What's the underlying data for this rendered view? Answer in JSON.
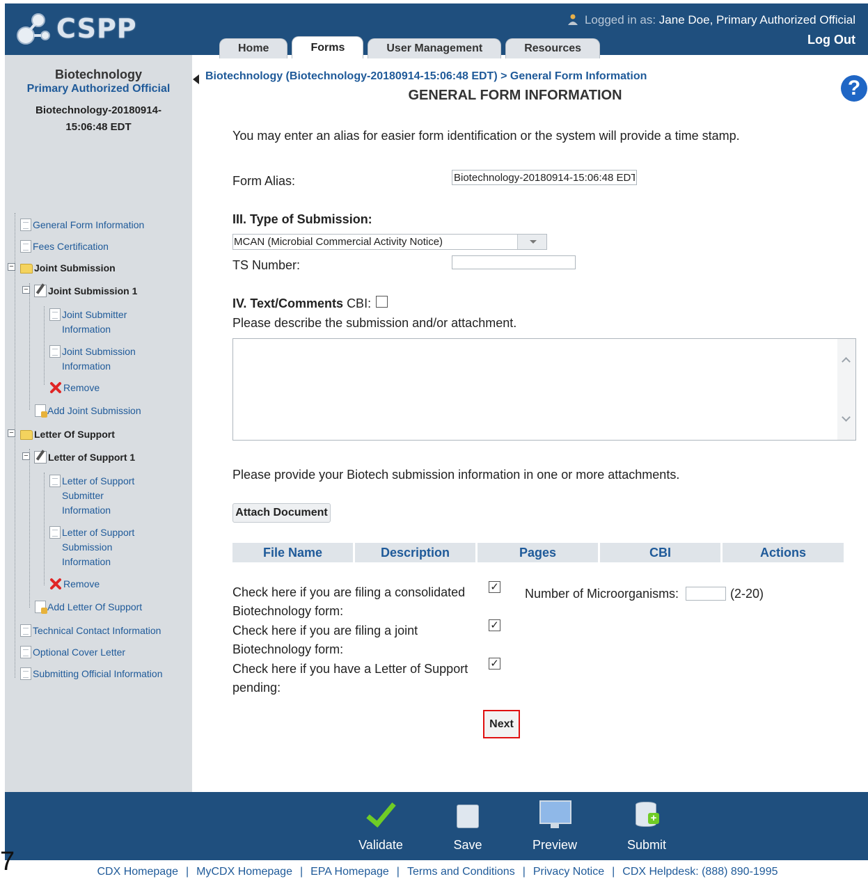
{
  "header": {
    "logo_text": "CSPP",
    "login_prefix": "Logged in as:",
    "user": "Jane Doe, Primary Authorized Official",
    "logout": "Log Out",
    "tabs": [
      "Home",
      "Forms",
      "User Management",
      "Resources"
    ],
    "active_tab": "Forms"
  },
  "sidebar": {
    "title": "Biotechnology",
    "role": "Primary Authorized Official",
    "form_id_line1": "Biotechnology-20180914-",
    "form_id_line2": "15:06:48 EDT",
    "tree": {
      "general_form_information": "General Form Information",
      "fees_certification": "Fees Certification",
      "joint_submission": "Joint Submission",
      "joint_submission_1": "Joint Submission 1",
      "joint_submitter_information_1": "Joint Submitter",
      "joint_submitter_information_2": "Information",
      "joint_submission_information_1": "Joint Submission",
      "joint_submission_information_2": "Information",
      "remove_1": "Remove",
      "add_joint_submission": "Add Joint Submission",
      "letter_of_support": "Letter Of Support",
      "letter_of_support_1": "Letter of Support 1",
      "los_submitter_1": "Letter of Support",
      "los_submitter_2": "Submitter",
      "los_submitter_3": "Information",
      "los_submission_1": "Letter of Support",
      "los_submission_2": "Submission",
      "los_submission_3": "Information",
      "remove_2": "Remove",
      "add_letter_of_support": "Add Letter Of Support",
      "technical_contact_information": "Technical Contact Information",
      "optional_cover_letter": "Optional Cover Letter",
      "submitting_official_information": "Submitting Official Information"
    }
  },
  "main": {
    "breadcrumb": "Biotechnology (Biotechnology-20180914-15:06:48 EDT) > General Form Information",
    "page_title": "GENERAL FORM INFORMATION",
    "help_icon": "?",
    "intro": "You may enter an alias for easier form identification or the system will provide a time stamp.",
    "form_alias_label": "Form Alias:",
    "form_alias_value": "Biotechnology-20180914-15:06:48 EDT",
    "type_heading": "III. Type of Submission:",
    "type_selected": "MCAN (Microbial Commercial Activity Notice)",
    "ts_number_label": "TS Number:",
    "ts_number_value": "",
    "text_comments_heading": "IV. Text/Comments",
    "cbi_label": "CBI:",
    "cbi_checked": false,
    "describe_label": "Please describe the submission and/or attachment.",
    "comments_value": "",
    "attach_prompt": "Please provide your Biotech submission information in one or more attachments.",
    "attach_button": "Attach Document",
    "attachments_columns": [
      "File Name",
      "Description",
      "Pages",
      "CBI",
      "Actions"
    ],
    "consolidated_line1": "Check here if you are filing a consolidated",
    "consolidated_line2": "Biotechnology form:",
    "consolidated_checked": true,
    "joint_line1": "Check here if you are filing a joint",
    "joint_line2": "Biotechnology form:",
    "joint_checked": true,
    "letter_line1": "Check here if you have a Letter of Support",
    "letter_line2": "pending:",
    "letter_checked": true,
    "microorganisms_label": "Number of Microorganisms:",
    "microorganisms_value": "",
    "microorganisms_range": "(2-20)",
    "next_button": "Next"
  },
  "footer": {
    "actions": [
      "Validate",
      "Save",
      "Preview",
      "Submit"
    ],
    "links": [
      "CDX Homepage",
      "MyCDX Homepage",
      "EPA Homepage",
      "Terms and Conditions",
      "Privacy Notice",
      "CDX Helpdesk: (888) 890-1995"
    ],
    "link_separator": "|",
    "corner_mark": "7"
  },
  "colors": {
    "header_blue": "#1f4f7e",
    "link_blue": "#1f5a99",
    "sidebar_gray": "#d9dde1",
    "next_highlight": "#e01010",
    "validate_green": "#6fcc26"
  },
  "icons": {
    "logo": "molecule-logo-icon",
    "user": "user-icon",
    "help": "help-icon",
    "doc": "document-icon",
    "folder": "folder-icon",
    "edit": "edit-form-icon",
    "remove": "red-x-icon",
    "add": "add-document-icon",
    "validate": "checkmark-icon",
    "save": "floppy-disk-icon",
    "preview": "monitor-icon",
    "submit": "database-add-icon"
  }
}
